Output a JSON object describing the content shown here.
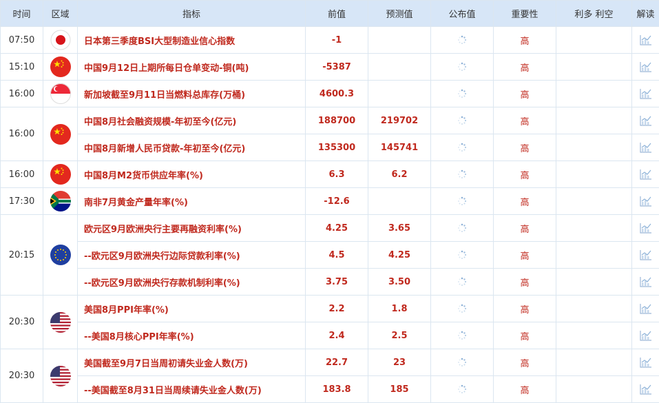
{
  "columns": {
    "time": "时间",
    "region": "区域",
    "indicator": "指标",
    "previous": "前值",
    "forecast": "预测值",
    "actual": "公布值",
    "importance": "重要性",
    "impact": "利多 利空",
    "analysis": "解读"
  },
  "groups": [
    {
      "time": "07:50",
      "flag": "japan-flag-icon",
      "rows": [
        {
          "indicator": "日本第三季度BSI大型制造业信心指数",
          "previous": "-1",
          "forecast": "",
          "importance": "高"
        }
      ]
    },
    {
      "time": "15:10",
      "flag": "china-flag-icon",
      "rows": [
        {
          "indicator": "中国9月12日上期所每日仓单变动-铜(吨)",
          "previous": "-5387",
          "forecast": "",
          "importance": "高"
        }
      ]
    },
    {
      "time": "16:00",
      "flag": "singapore-flag-icon",
      "rows": [
        {
          "indicator": "新加坡截至9月11日当燃料总库存(万桶)",
          "previous": "4600.3",
          "forecast": "",
          "importance": "高"
        }
      ]
    },
    {
      "time": "16:00",
      "flag": "china-flag-icon",
      "rows": [
        {
          "indicator": "中国8月社会融资规模-年初至今(亿元)",
          "previous": "188700",
          "forecast": "219702",
          "importance": "高"
        },
        {
          "indicator": "中国8月新增人民币贷款-年初至今(亿元)",
          "previous": "135300",
          "forecast": "145741",
          "importance": "高"
        }
      ]
    },
    {
      "time": "16:00",
      "flag": "china-flag-icon",
      "rows": [
        {
          "indicator": "中国8月M2货币供应年率(%)",
          "previous": "6.3",
          "forecast": "6.2",
          "importance": "高"
        }
      ]
    },
    {
      "time": "17:30",
      "flag": "south-africa-flag-icon",
      "rows": [
        {
          "indicator": "南非7月黄金产量年率(%)",
          "previous": "-12.6",
          "forecast": "",
          "importance": "高"
        }
      ]
    },
    {
      "time": "20:15",
      "flag": "eu-flag-icon",
      "rows": [
        {
          "indicator": "欧元区9月欧洲央行主要再融资利率(%)",
          "previous": "4.25",
          "forecast": "3.65",
          "importance": "高"
        },
        {
          "indicator": "--欧元区9月欧洲央行边际贷款利率(%)",
          "previous": "4.5",
          "forecast": "4.25",
          "importance": "高"
        },
        {
          "indicator": "--欧元区9月欧洲央行存款机制利率(%)",
          "previous": "3.75",
          "forecast": "3.50",
          "importance": "高"
        }
      ]
    },
    {
      "time": "20:30",
      "flag": "usa-flag-icon",
      "rows": [
        {
          "indicator": "美国8月PPI年率(%)",
          "previous": "2.2",
          "forecast": "1.8",
          "importance": "高"
        },
        {
          "indicator": "--美国8月核心PPI年率(%)",
          "previous": "2.4",
          "forecast": "2.5",
          "importance": "高"
        }
      ]
    },
    {
      "time": "20:30",
      "flag": "usa-flag-icon",
      "rows": [
        {
          "indicator": "美国截至9月7日当周初请失业金人数(万)",
          "previous": "22.7",
          "forecast": "23",
          "importance": "高"
        },
        {
          "indicator": "--美国截至8月31日当周续请失业金人数(万)",
          "previous": "183.8",
          "forecast": "185",
          "importance": "高"
        }
      ]
    }
  ]
}
